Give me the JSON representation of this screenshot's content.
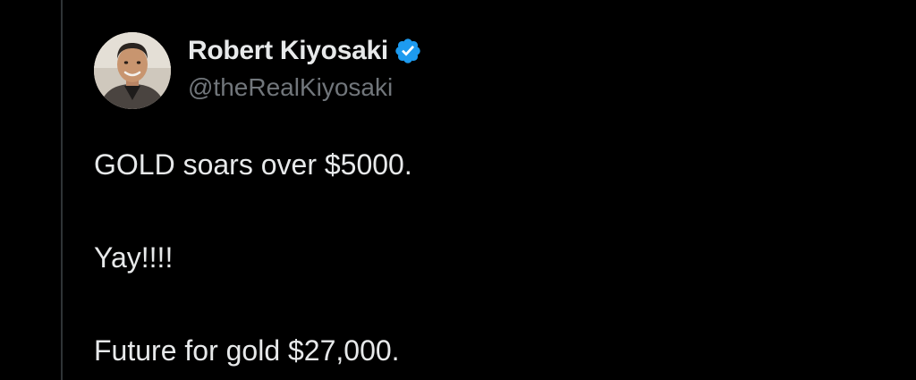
{
  "tweet": {
    "author": {
      "display_name": "Robert Kiyosaki",
      "handle": "@theRealKiyosaki",
      "verified": true,
      "avatar_icon": "profile-photo",
      "verified_icon": "verified-checkmark-icon"
    },
    "text_lines": [
      "GOLD soars over $5000.",
      "Yay!!!!",
      "Future for gold $27,000."
    ]
  },
  "colors": {
    "background": "#000000",
    "primary_text": "#e7e9ea",
    "secondary_text": "#71767b",
    "verified_blue": "#1d9bf0",
    "border": "#2f3336"
  }
}
